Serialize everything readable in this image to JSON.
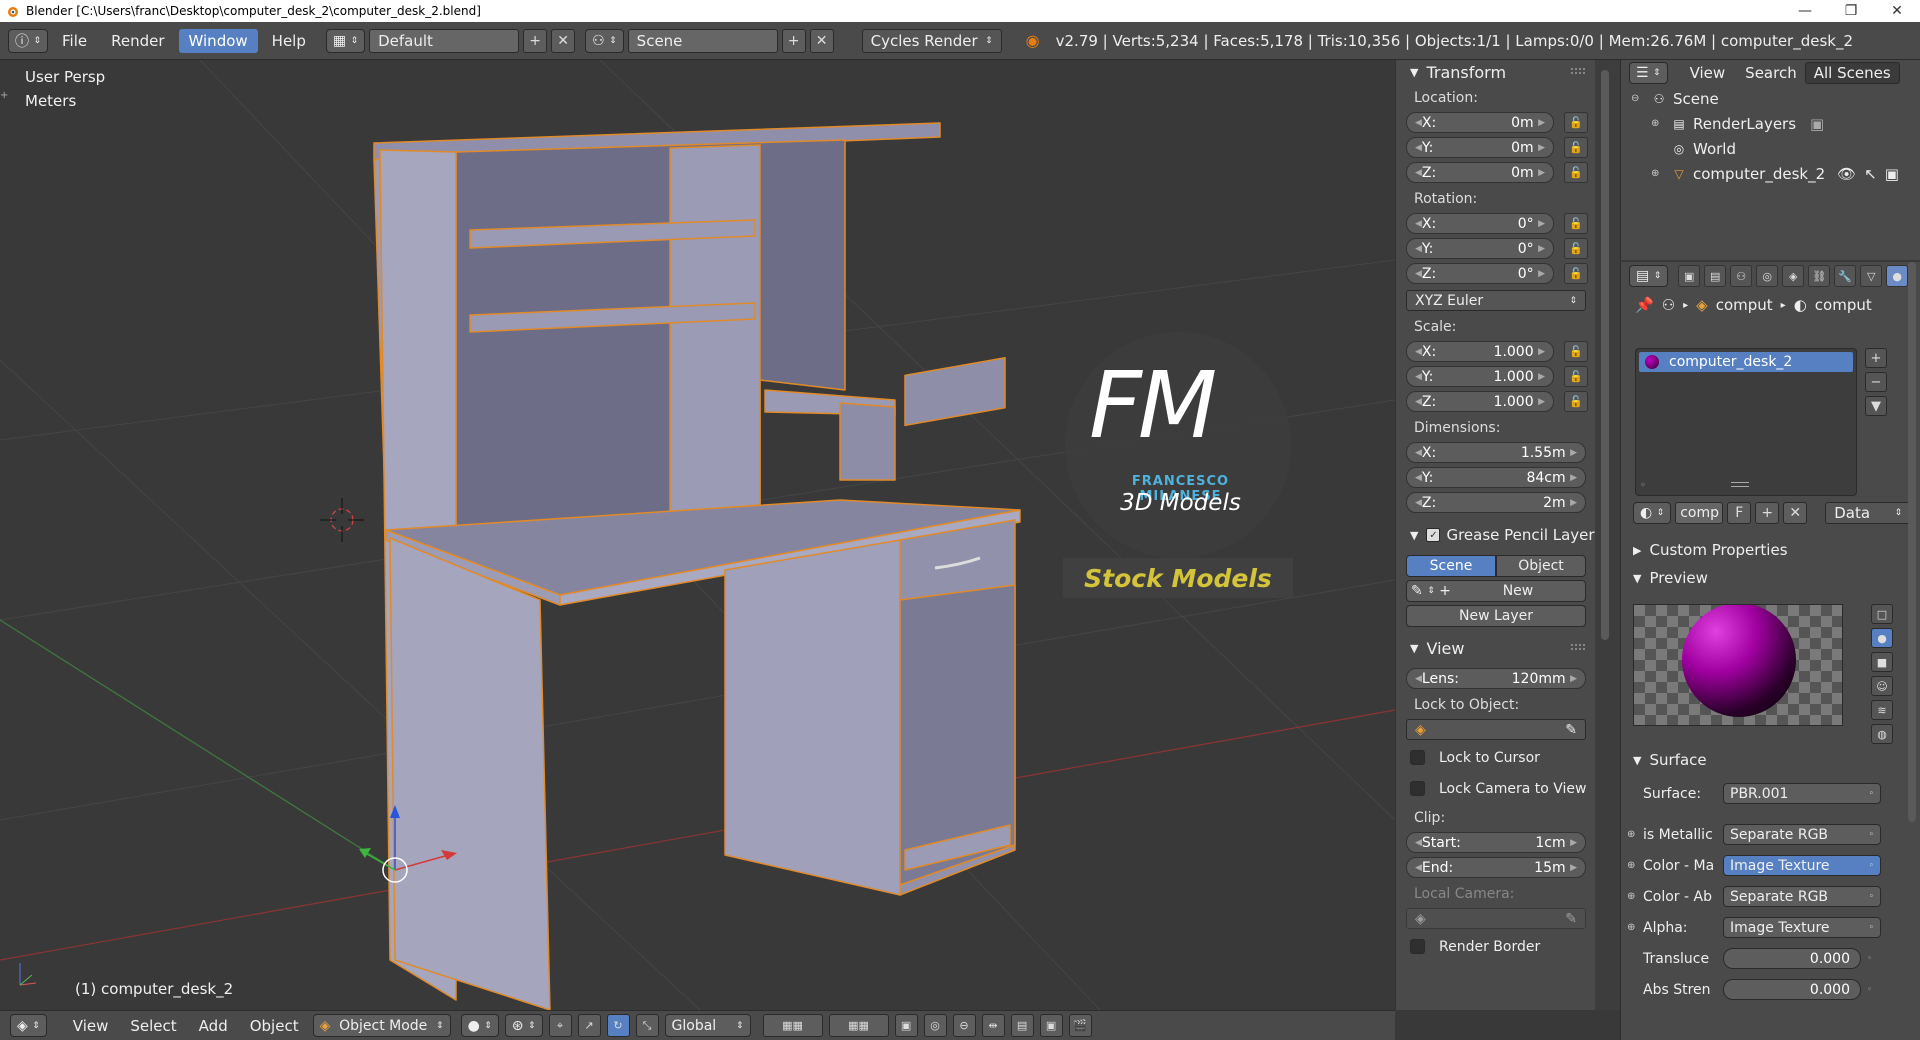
{
  "window": {
    "title": "Blender [C:\\Users\\franc\\Desktop\\computer_desk_2\\computer_desk_2.blend]",
    "minimize": "—",
    "maximize": "❐",
    "close": "✕"
  },
  "menu": {
    "items": [
      "File",
      "Render",
      "Window",
      "Help"
    ],
    "active": "Window"
  },
  "header": {
    "layout": "Default",
    "scene": "Scene",
    "render_engine": "Cycles Render",
    "stats": "v2.79 | Verts:5,234 | Faces:5,178 | Tris:10,356 | Objects:1/1 | Lamps:0/0 | Mem:26.76M | computer_desk_2"
  },
  "viewport": {
    "view_name": "User Persp",
    "units": "Meters",
    "object_label": "(1) computer_desk_2"
  },
  "watermark": {
    "logo": "FM",
    "brand": "FRANCESCO MILANESE",
    "tagline": "3D Models",
    "banner": "Stock Models"
  },
  "npanel": {
    "transform": {
      "title": "Transform",
      "location_label": "Location:",
      "location": {
        "x": "0m",
        "y": "0m",
        "z": "0m"
      },
      "rotation_label": "Rotation:",
      "rotation": {
        "x": "0°",
        "y": "0°",
        "z": "0°"
      },
      "rotation_mode": "XYZ Euler",
      "scale_label": "Scale:",
      "scale": {
        "x": "1.000",
        "y": "1.000",
        "z": "1.000"
      },
      "dimensions_label": "Dimensions:",
      "dimensions": {
        "x": "1.55m",
        "y": "84cm",
        "z": "2m"
      },
      "axis_x": "X:",
      "axis_y": "Y:",
      "axis_z": "Z:"
    },
    "grease_pencil": {
      "title": "Grease Pencil Layer",
      "scene_tab": "Scene",
      "object_tab": "Object",
      "new_label": "New",
      "new_layer_label": "New Layer"
    },
    "view": {
      "title": "View",
      "lens_label": "Lens:",
      "lens_value": "120mm",
      "lock_to_object": "Lock to Object:",
      "lock_to_cursor": "Lock to Cursor",
      "lock_camera": "Lock Camera to View",
      "clip_label": "Clip:",
      "clip_start_label": "Start:",
      "clip_start": "1cm",
      "clip_end_label": "End:",
      "clip_end": "15m",
      "local_camera": "Local Camera:",
      "render_border": "Render Border"
    }
  },
  "outliner": {
    "view": "View",
    "search": "Search",
    "filter": "All Scenes",
    "items": [
      {
        "label": "Scene"
      },
      {
        "label": "RenderLayers"
      },
      {
        "label": "World"
      },
      {
        "label": "computer_desk_2"
      }
    ]
  },
  "properties": {
    "crumb_1": "comput",
    "crumb_2": "comput",
    "material_name": "computer_desk_2",
    "slot_short": "comp",
    "fake_user": "F",
    "data_mode": "Data",
    "custom_properties": "Custom Properties",
    "preview": "Preview",
    "surface_section": "Surface",
    "surface_label": "Surface:",
    "surface_value": "PBR.001",
    "inputs": [
      {
        "label": "is Metallic",
        "value": "Separate RGB"
      },
      {
        "label": "Color - Ma",
        "value": "Image Texture"
      },
      {
        "label": "Color - Ab",
        "value": "Separate RGB"
      },
      {
        "label": "Alpha:",
        "value": "Image Texture"
      }
    ],
    "translucency_label": "Transluce",
    "translucency": "0.000",
    "abs_strength_label": "Abs Stren",
    "abs_strength": "0.000"
  },
  "bottombar": {
    "view": "View",
    "select": "Select",
    "add": "Add",
    "object": "Object",
    "mode": "Object Mode",
    "orientation": "Global"
  },
  "colors": {
    "accent": "#5680c2",
    "selection_outline": "#e08a2a",
    "mesh": "#8d8da8",
    "background": "#393939"
  }
}
